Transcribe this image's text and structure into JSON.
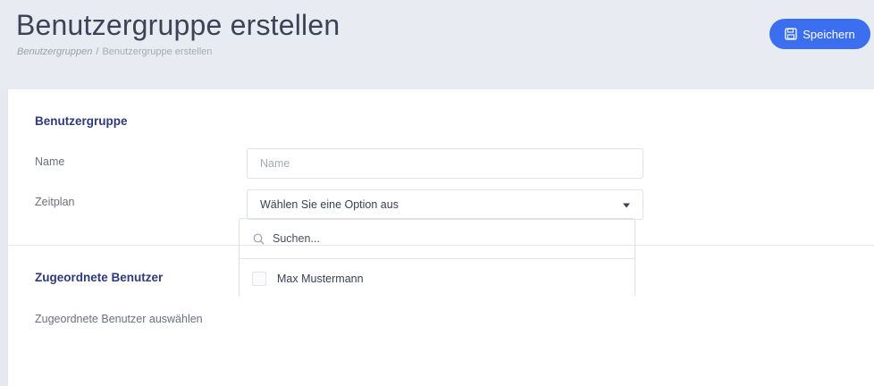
{
  "header": {
    "title": "Benutzergruppe erstellen",
    "breadcrumb": {
      "link": "Benutzergruppen",
      "separator": "/",
      "current": "Benutzergruppe erstellen"
    },
    "save_label": "Speichern",
    "save_icon": "floppy-disk-icon"
  },
  "group_section": {
    "title": "Benutzergruppe",
    "name_label": "Name",
    "name_placeholder": "Name",
    "schedule_label": "Zeitplan",
    "schedule_value": "Wählen Sie eine Option aus"
  },
  "users_section": {
    "title": "Zugeordnete Benutzer",
    "select_label": "Zugeordnete Benutzer auswählen",
    "search_placeholder": "Suchen...",
    "users": [
      {
        "name": "Max Mustermann",
        "checked": false
      }
    ]
  },
  "colors": {
    "accent": "#3b6ff0",
    "section_title": "#2e3a7a",
    "header_bg": "#e8ebf1"
  }
}
